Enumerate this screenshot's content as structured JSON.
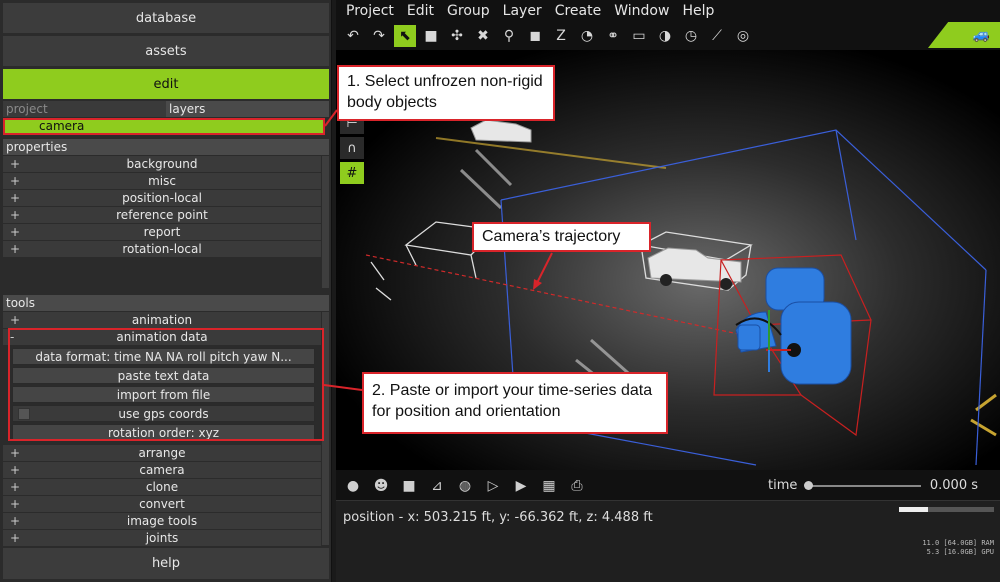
{
  "nav": {
    "database": "database",
    "assets": "assets",
    "edit": "edit"
  },
  "tabs": {
    "project": "project",
    "layers": "layers"
  },
  "layer_item": "camera",
  "properties": {
    "header": "properties",
    "items": [
      "background",
      "misc",
      "position-local",
      "reference point",
      "report",
      "rotation-local"
    ]
  },
  "tools": {
    "header": "tools",
    "animation": "animation",
    "animation_data": "animation data",
    "sub": {
      "data_format": "data format: time NA NA roll pitch yaw N...",
      "paste_text": "paste text data",
      "import_file": "import from file",
      "use_gps": "use gps coords",
      "rotation_order": "rotation order: xyz"
    },
    "items": [
      "arrange",
      "camera",
      "clone",
      "convert",
      "image tools",
      "joints"
    ]
  },
  "help": "help",
  "menubar": [
    "Project",
    "Edit",
    "Group",
    "Layer",
    "Create",
    "Window",
    "Help"
  ],
  "toolbar_icons": [
    "undo-icon",
    "redo-icon",
    "select-icon",
    "box-icon",
    "vehicle-icon",
    "delete-icon",
    "zoom-icon",
    "cube-icon",
    "z-axis-icon",
    "clock-icon",
    "link-icon",
    "comment-icon",
    "gauge-icon",
    "timer-icon",
    "ruler-icon",
    "help-icon"
  ],
  "viewport_tools": [
    "axis-icon",
    "magnet-icon",
    "grid-icon"
  ],
  "bottom_icons": [
    "sphere-icon",
    "head-icon",
    "square-icon",
    "graph-icon",
    "camera-icon",
    "play-icon",
    "step-icon",
    "calculator-icon",
    "print-icon"
  ],
  "timeline": {
    "label": "time",
    "value": "0.000 s"
  },
  "status": {
    "position": "position - x: 503.215 ft, y: -66.362 ft, z: 4.488 ft",
    "ram": "11.0 [64.0GB] RAM",
    "gpu": "5.3 [16.0GB] GPU",
    "mem_fraction": 0.3
  },
  "callouts": {
    "c1": "1. Select unfrozen non-rigid body objects",
    "c2": "Camera’s trajectory",
    "c3": "2. Paste or import your time-series data for position and orientation"
  },
  "colors": {
    "accent": "#8fcc1e",
    "callout_border": "#d9242a",
    "object_blue": "#2f7de0"
  }
}
